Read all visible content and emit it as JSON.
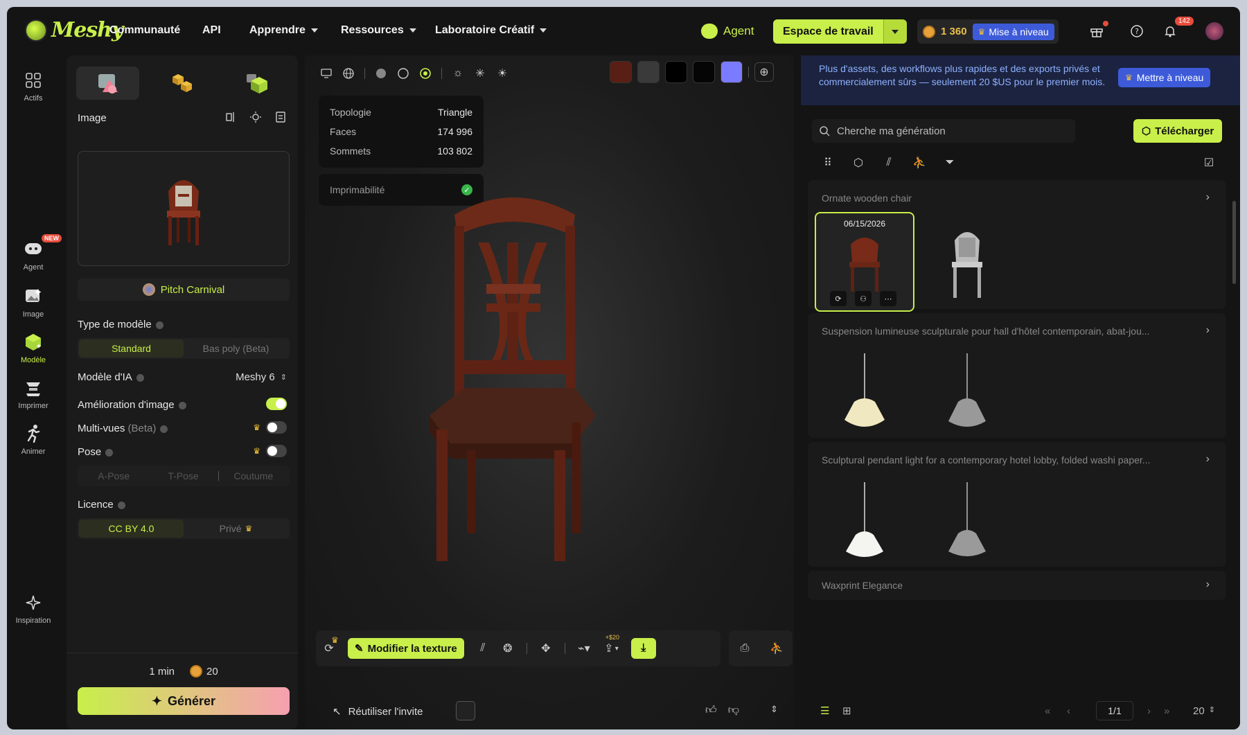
{
  "nav": {
    "brand": "Meshy",
    "links": [
      {
        "label": "Communauté"
      },
      {
        "label": "API"
      },
      {
        "label": "Apprendre"
      },
      {
        "label": "Ressources"
      },
      {
        "label": "Laboratoire Créatif"
      }
    ],
    "agent_label": "Agent",
    "workspace_label": "Espace de travail",
    "credits": "1 360",
    "upgrade_label": "Mise à niveau",
    "notifications_count": "142"
  },
  "rail": [
    {
      "label": "Actifs"
    },
    {
      "label": "Agent",
      "badge": "NEW"
    },
    {
      "label": "Image"
    },
    {
      "label": "Modèle"
    },
    {
      "label": "Imprimer"
    },
    {
      "label": "Animer"
    },
    {
      "label": "Inspiration"
    }
  ],
  "left": {
    "image_label": "Image",
    "pitch": "Pitch Carnival",
    "model_type_label": "Type de modèle",
    "model_types": [
      "Standard",
      "Bas poly (Beta)"
    ],
    "ai_model_label": "Modèle d'IA",
    "ai_model_value": "Meshy 6",
    "enhance_label": "Amélioration d'image",
    "multiview_label": "Multi-vues",
    "multiview_beta": "(Beta)",
    "pose_label": "Pose",
    "poses": [
      "A-Pose",
      "T-Pose",
      "Coutume"
    ],
    "license_label": "Licence",
    "licenses": [
      "CC BY 4.0",
      "Privé"
    ],
    "time": "1 min",
    "cost": "20",
    "generate": "Générer"
  },
  "viewer": {
    "stats": [
      {
        "label": "Topologie",
        "value": "Triangle"
      },
      {
        "label": "Faces",
        "value": "174 996"
      },
      {
        "label": "Sommets",
        "value": "103 802"
      }
    ],
    "printability": "Imprimabilité",
    "swatches": [
      "#5a1f14",
      "#3a3a3a",
      "#000000",
      "#050505",
      "#7b7bff"
    ],
    "modify_texture": "Modifier la texture",
    "export_cost": "+$20",
    "reuse_prompt": "Réutiliser l'invite"
  },
  "right": {
    "promo": "Plus d'assets, des workflows plus rapides et des exports privés et commercialement sûrs — seulement 20 $US pour le premier mois.",
    "promo_btn": "Mettre à niveau",
    "search_placeholder": "Cherche ma génération",
    "download": "Télécharger",
    "groups": [
      {
        "title": "Ornate wooden chair",
        "date": "06/15/2026"
      },
      {
        "title": "Suspension lumineuse sculpturale pour hall d'hôtel contemporain, abat-jou..."
      },
      {
        "title": "Sculptural pendant light for a contemporary hotel lobby, folded washi paper..."
      },
      {
        "title": "Waxprint Elegance"
      }
    ],
    "page": "1/1",
    "per_page": "20"
  }
}
